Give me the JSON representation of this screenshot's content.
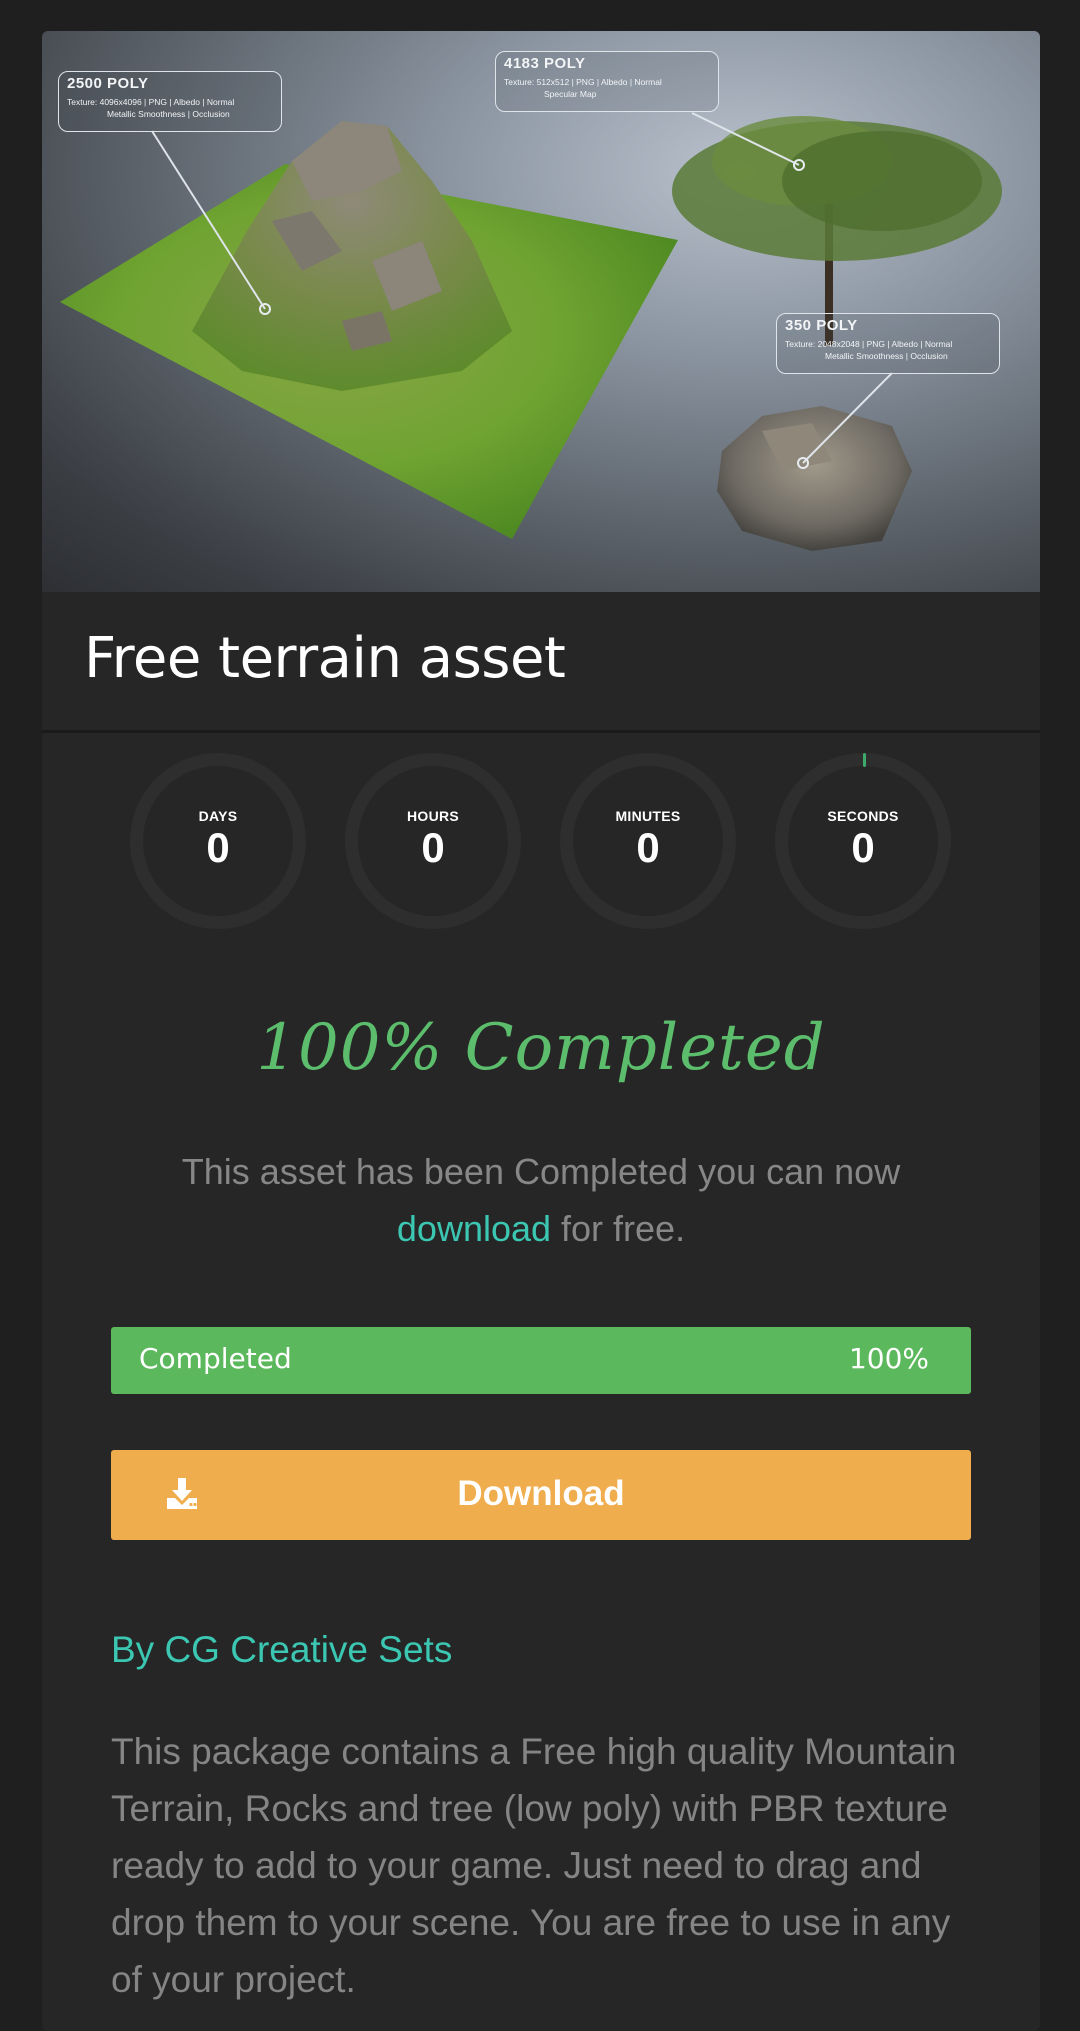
{
  "hero": {
    "callouts": [
      {
        "poly": "2500 POLY",
        "texture_line1": "Texture: 4096x4096 | PNG | Albedo | Normal",
        "texture_line2": "Metallic Smoothness | Occlusion"
      },
      {
        "poly": "4183 POLY",
        "texture_line1": "Texture: 512x512 | PNG | Albedo | Normal",
        "texture_line2": "Specular Map"
      },
      {
        "poly": "350 POLY",
        "texture_line1": "Texture: 2048x2048 | PNG | Albedo | Normal",
        "texture_line2": "Metallic Smoothness | Occlusion"
      }
    ]
  },
  "title": "Free terrain asset",
  "countdown": [
    {
      "label": "DAYS",
      "value": "0"
    },
    {
      "label": "HOURS",
      "value": "0"
    },
    {
      "label": "MINUTES",
      "value": "0"
    },
    {
      "label": "SECONDS",
      "value": "0"
    }
  ],
  "status_heading": "100% Completed",
  "description": {
    "before": "This asset has been Completed you can now",
    "link": "download",
    "after": " for free."
  },
  "progress": {
    "label": "Completed",
    "value_text": "100%",
    "value": 1.0
  },
  "download_button": {
    "label": "Download",
    "icon": "download-icon"
  },
  "author": "By CG Creative Sets",
  "body": "This package contains a Free high quality Mountain Terrain, Rocks and tree (low poly) with PBR texture ready to add to your game. Just need to drag and drop them to your scene. You are free to use in any of your project.",
  "colors": {
    "accent_green": "#5cb85c",
    "heading_green": "#5cbd6c",
    "teal_link": "#3bc7b2",
    "download_orange": "#f0ad4e",
    "card_bg": "#262626",
    "page_bg": "#1f1f1f"
  }
}
